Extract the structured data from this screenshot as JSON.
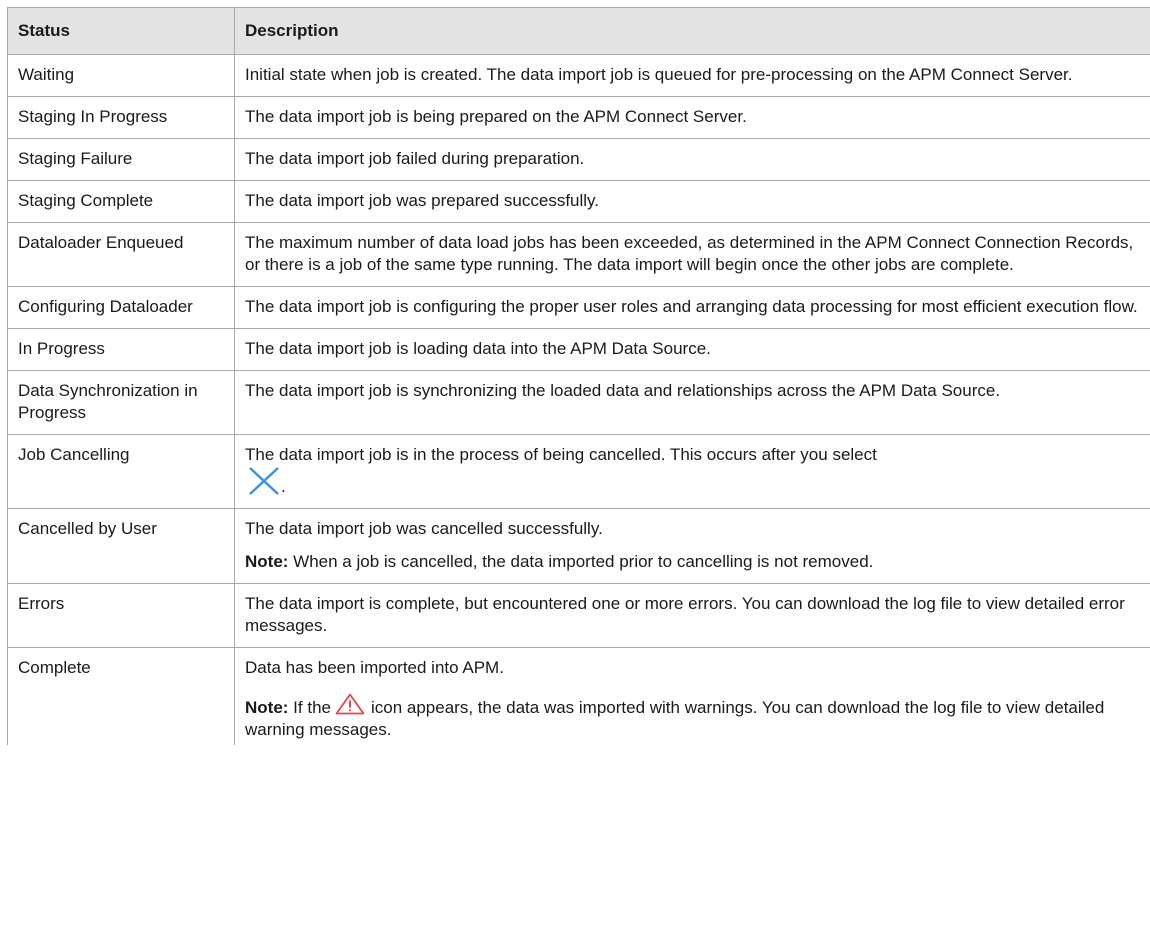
{
  "table": {
    "headers": {
      "status": "Status",
      "description": "Description"
    },
    "rows": [
      {
        "status": "Waiting",
        "description": "Initial state when job is created. The data import job is queued for pre-processing on the APM Connect Server."
      },
      {
        "status": "Staging In Progress",
        "description": "The data import job is being prepared on the APM Connect Server."
      },
      {
        "status": "Staging Failure",
        "description": "The data import job failed during preparation."
      },
      {
        "status": "Staging Complete",
        "description": "The data import job was prepared successfully."
      },
      {
        "status": "Dataloader Enqueued",
        "description": "The maximum number of data load jobs has been exceeded, as determined in the APM Connect Connection Records, or there is a job of the same type running. The data import will begin once the other jobs are complete."
      },
      {
        "status": "Configuring Dataloader",
        "description": "The data import job is configuring the proper user roles and arranging data processing for most efficient execution flow."
      },
      {
        "status": "In Progress",
        "description": "The data import job is loading data into the APM Data Source."
      },
      {
        "status": "Data Synchronization in Progress",
        "description": "The data import job is synchronizing the loaded data and relationships across the APM Data Source."
      },
      {
        "status": "Job Cancelling",
        "description": "The data import job is in the process of being cancelled. This occurs after you select",
        "icon": "close-x-icon",
        "trailing": "."
      },
      {
        "status": "Cancelled by User",
        "description": "The data import job was cancelled successfully.",
        "note_label": "Note:",
        "note_text": " When a job is cancelled, the data imported prior to cancelling is not removed."
      },
      {
        "status": "Errors",
        "description": "The data import is complete, but encountered one or more errors. You can download the log file to view detailed error messages."
      },
      {
        "status": "Complete",
        "description": "Data has been imported into APM.",
        "note_label": "Note:",
        "note_prefix": " If the",
        "icon": "warning-triangle-icon",
        "note_suffix": "icon appears, the data was imported with warnings. You can download the log file to view detailed warning messages."
      }
    ]
  },
  "colors": {
    "header_bg": "#e3e3e3",
    "border": "#a8a8a8",
    "close_icon": "#3a8fe0",
    "warning_icon": "#e8434f"
  }
}
